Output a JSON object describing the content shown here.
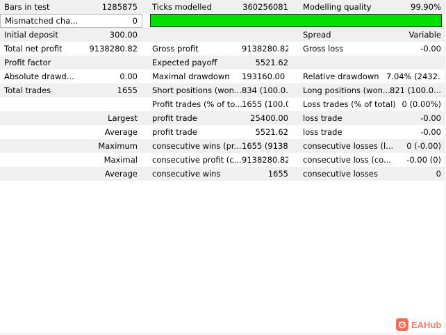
{
  "rows": [
    {
      "c1": "Bars in test",
      "c2": "1285875",
      "c3": "Ticks modelled",
      "c4": "360256081",
      "c5": "Modelling quality",
      "c6": "99.90%"
    },
    {
      "mismatched_label": "Mismatched cha...",
      "mismatched_value": "0",
      "quality_percent": 99.9
    },
    {
      "c1": "Initial deposit",
      "c2": "300.00",
      "c3": "",
      "c4": "",
      "c5": "Spread",
      "c6": "Variable"
    },
    {
      "c1": "Total net profit",
      "c2": "9138280.82",
      "c3": "Gross profit",
      "c4": "9138280.82",
      "c5": "Gross loss",
      "c6": "-0.00"
    },
    {
      "c1": "Profit factor",
      "c2": "",
      "c3": "Expected payoff",
      "c4": "5521.62",
      "c5": "",
      "c6": ""
    },
    {
      "c1": "Absolute drawd...",
      "c2": "0.00",
      "c3": "Maximal drawdown",
      "c4": "193160.00 (...",
      "c5": "Relative drawdown",
      "c6": "7.04% (2432..."
    },
    {
      "c1": "Total trades",
      "c2": "1655",
      "c3": "Short positions (won...",
      "c4": "834 (100.0...",
      "c5": "Long positions (won...",
      "c6": "821 (100.0..."
    },
    {
      "c1": "",
      "c2": "",
      "c3": "Profit trades (% of to...",
      "c4": "1655 (100.0...",
      "c5": "Loss trades (% of total)",
      "c6": "0 (0.00%)"
    },
    {
      "c1": "",
      "c2": "Largest",
      "c3": "profit trade",
      "c4": "25400.00",
      "c5": "loss trade",
      "c6": "-0.00"
    },
    {
      "c1": "",
      "c2": "Average",
      "c3": "profit trade",
      "c4": "5521.62",
      "c5": "loss trade",
      "c6": "-0.00"
    },
    {
      "c1": "",
      "c2": "Maximum",
      "c3": "consecutive wins (pr...",
      "c4": "1655 (9138...",
      "c5": "consecutive losses (l...",
      "c6": "0 (-0.00)"
    },
    {
      "c1": "",
      "c2": "Maximal",
      "c3": "consecutive profit (c...",
      "c4": "9138280.82...",
      "c5": "consecutive loss (co...",
      "c6": "-0.00 (0)"
    },
    {
      "c1": "",
      "c2": "Average",
      "c3": "consecutive wins",
      "c4": "1655",
      "c5": "consecutive losses",
      "c6": "0"
    }
  ],
  "watermark": {
    "text": "EAHub",
    "icon": "eahub-logo-icon",
    "color": "#f07d6e"
  },
  "colors": {
    "row_shade": "#f0f0f0",
    "quality_bar": "#00e000"
  }
}
